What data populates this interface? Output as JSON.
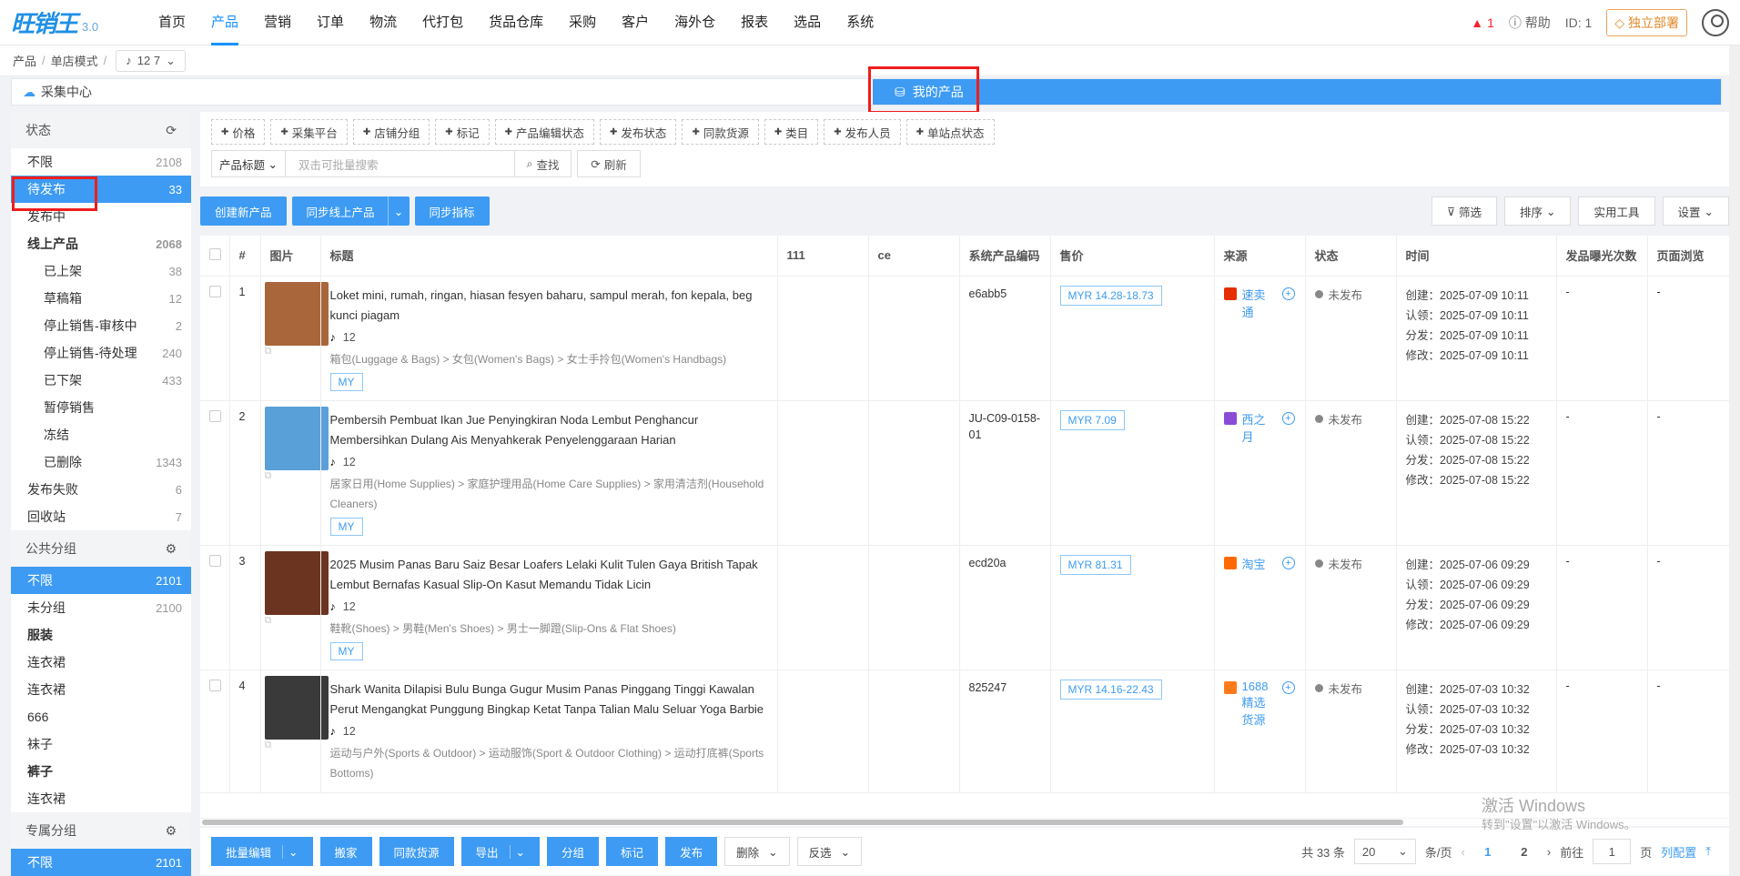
{
  "app": {
    "logo": "旺销王",
    "version": "3.0"
  },
  "nav": {
    "items": [
      "首页",
      "产品",
      "营销",
      "订单",
      "物流",
      "代打包",
      "货品仓库",
      "采购",
      "客户",
      "海外仓",
      "报表",
      "选品",
      "系统"
    ],
    "active_index": 1,
    "warn_count": "1",
    "help": "帮助",
    "id_label": "ID: 1",
    "deploy": "独立部署"
  },
  "breadcrumb": {
    "items": [
      "产品",
      "单店模式"
    ],
    "shop": "12 7"
  },
  "collect": {
    "label": "采集中心",
    "my_products": "我的产品"
  },
  "sidebar": {
    "status_head": "状态",
    "status_items": [
      {
        "label": "不限",
        "count": "2108",
        "type": "plain"
      },
      {
        "label": "待发布",
        "count": "33",
        "type": "sel"
      },
      {
        "label": "发布中",
        "count": "",
        "type": "plain"
      },
      {
        "label": "线上产品",
        "count": "2068",
        "type": "bold"
      },
      {
        "label": "已上架",
        "count": "38",
        "type": "sub"
      },
      {
        "label": "草稿箱",
        "count": "12",
        "type": "sub"
      },
      {
        "label": "停止销售-审核中",
        "count": "2",
        "type": "sub"
      },
      {
        "label": "停止销售-待处理",
        "count": "240",
        "type": "sub"
      },
      {
        "label": "已下架",
        "count": "433",
        "type": "sub"
      },
      {
        "label": "暂停销售",
        "count": "",
        "type": "sub"
      },
      {
        "label": "冻结",
        "count": "",
        "type": "sub"
      },
      {
        "label": "已删除",
        "count": "1343",
        "type": "sub"
      },
      {
        "label": "发布失败",
        "count": "6",
        "type": "plain"
      },
      {
        "label": "回收站",
        "count": "7",
        "type": "plain"
      }
    ],
    "public_head": "公共分组",
    "public_items": [
      {
        "label": "不限",
        "count": "2101",
        "type": "sel"
      },
      {
        "label": "未分组",
        "count": "2100",
        "type": "plain"
      },
      {
        "label": "服装",
        "count": "",
        "type": "bold"
      },
      {
        "label": "连衣裙",
        "count": "",
        "type": "plain"
      },
      {
        "label": "连衣裙",
        "count": "",
        "type": "plain"
      },
      {
        "label": "666",
        "count": "",
        "type": "plain"
      },
      {
        "label": "袜子",
        "count": "",
        "type": "plain"
      },
      {
        "label": "裤子",
        "count": "",
        "type": "bold"
      },
      {
        "label": "连衣裙",
        "count": "",
        "type": "plain"
      }
    ],
    "private_head": "专属分组",
    "private_items": [
      {
        "label": "不限",
        "count": "2101",
        "type": "sel"
      }
    ]
  },
  "filters": {
    "chips": [
      "价格",
      "采集平台",
      "店铺分组",
      "标记",
      "产品编辑状态",
      "发布状态",
      "同款货源",
      "类目",
      "发布人员",
      "单站点状态"
    ],
    "field": "产品标题",
    "placeholder": "双击可批量搜索",
    "search": "查找",
    "refresh": "刷新"
  },
  "actions": {
    "create": "创建新产品",
    "sync": "同步线上产品",
    "sync_metric": "同步指标",
    "filter": "筛选",
    "sort": "排序",
    "tools": "实用工具",
    "settings": "设置"
  },
  "table": {
    "headers": [
      "#",
      "图片",
      "标题",
      "111",
      "ce",
      "系统产品编码",
      "售价",
      "来源",
      "状态",
      "时间",
      "发品曝光次数",
      "页面浏览"
    ],
    "rows": [
      {
        "no": "1",
        "title": "Loket mini, rumah, ringan, hiasan fesyen baharu, sampul merah, fon kepala, beg kunci piagam",
        "shop": "12",
        "category": "箱包(Luggage & Bags) > 女包(Women's Bags) > 女士手拎包(Women's Handbags)",
        "market": "MY",
        "code": "e6abb5",
        "price": "MYR  14.28-18.73",
        "source": "速卖通",
        "source_color": "#e62e04",
        "status": "未发布",
        "created": "创建：2025-07-09 10:11",
        "claimed": "认领：2025-07-09 10:11",
        "distributed": "分发：2025-07-09 10:11",
        "modified": "修改：2025-07-09 10:11",
        "exposure": "-",
        "views": "-",
        "thumb": "#a8663a"
      },
      {
        "no": "2",
        "title": "Pembersih Pembuat Ikan Jue Penyingkiran Noda Lembut Penghancur Membersihkan Dulang Ais Menyahkerak Penyelenggaraan Harian",
        "shop": "12",
        "category": "居家日用(Home Supplies) > 家庭护理用品(Home Care Supplies) > 家用清洁剂(Household Cleaners)",
        "market": "MY",
        "code": "JU-C09-0158-01",
        "price": "MYR  7.09",
        "source": "西之月",
        "source_color": "#8a4bd6",
        "status": "未发布",
        "created": "创建：2025-07-08 15:22",
        "claimed": "认领：2025-07-08 15:22",
        "distributed": "分发：2025-07-08 15:22",
        "modified": "修改：2025-07-08 15:22",
        "exposure": "-",
        "views": "-",
        "thumb": "#5aa0d8"
      },
      {
        "no": "3",
        "title": "2025 Musim Panas Baru Saiz Besar Loafers Lelaki Kulit Tulen Gaya British Tapak Lembut Bernafas Kasual Slip-On Kasut Memandu Tidak Licin",
        "shop": "12",
        "category": "鞋靴(Shoes) > 男鞋(Men's Shoes) > 男士一脚蹬(Slip-Ons & Flat Shoes)",
        "market": "MY",
        "code": "ecd20a",
        "price": "MYR  81.31",
        "source": "淘宝",
        "source_color": "#ff6a00",
        "status": "未发布",
        "created": "创建：2025-07-06 09:29",
        "claimed": "认领：2025-07-06 09:29",
        "distributed": "分发：2025-07-06 09:29",
        "modified": "修改：2025-07-06 09:29",
        "exposure": "-",
        "views": "-",
        "thumb": "#6b3420"
      },
      {
        "no": "4",
        "title": "Shark Wanita Dilapisi Bulu Bunga Gugur Musim Panas Pinggang Tinggi Kawalan Perut Mengangkat Punggung Bingkap Ketat Tanpa Talian Malu Seluar Yoga Barbie",
        "shop": "12",
        "category": "运动与户外(Sports & Outdoor) > 运动服饰(Sport & Outdoor Clothing) > 运动打底裤(Sports Bottoms)",
        "market": "",
        "code": "825247",
        "price": "MYR  14.16-22.43",
        "source": "1688精选货源",
        "source_color": "#ff7a1a",
        "status": "未发布",
        "created": "创建：2025-07-03 10:32",
        "claimed": "认领：2025-07-03 10:32",
        "distributed": "分发：2025-07-03 10:32",
        "modified": "修改：2025-07-03 10:32",
        "exposure": "-",
        "views": "-",
        "thumb": "#3a3a3a"
      }
    ]
  },
  "bottom": {
    "batch_edit": "批量编辑",
    "move": "搬家",
    "same_source": "同款货源",
    "export": "导出",
    "group": "分组",
    "mark": "标记",
    "publish": "发布",
    "delete": "删除",
    "invert": "反选",
    "total": "共 33 条",
    "page_size": "20",
    "per_page": "条/页",
    "pages": [
      "1",
      "2"
    ],
    "goto": "前往",
    "page_input": "1",
    "page_unit": "页",
    "col_config": "列配置",
    "top": "⤒"
  },
  "watermark": {
    "line1": "激活 Windows",
    "line2": "转到\"设置\"以激活 Windows。"
  }
}
